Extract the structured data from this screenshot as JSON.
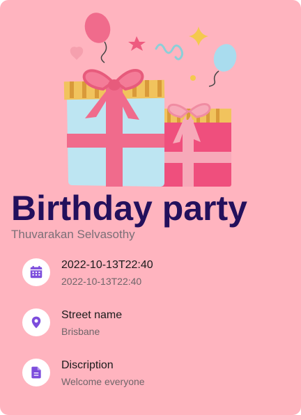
{
  "event": {
    "title": "Birthday party",
    "host": "Thuvarakan Selvasothy"
  },
  "details": [
    {
      "icon": "calendar-icon",
      "primary": "2022-10-13T22:40",
      "secondary": "2022-10-13T22:40"
    },
    {
      "icon": "location-pin-icon",
      "primary": "Street name",
      "secondary": "Brisbane"
    },
    {
      "icon": "document-icon",
      "primary": "Discription",
      "secondary": "Welcome everyone"
    }
  ],
  "colors": {
    "card_background": "#ffb4bf",
    "title": "#23105c",
    "icon_accent": "#7c4ddc"
  },
  "hero_image": "birthday-gifts-illustration"
}
